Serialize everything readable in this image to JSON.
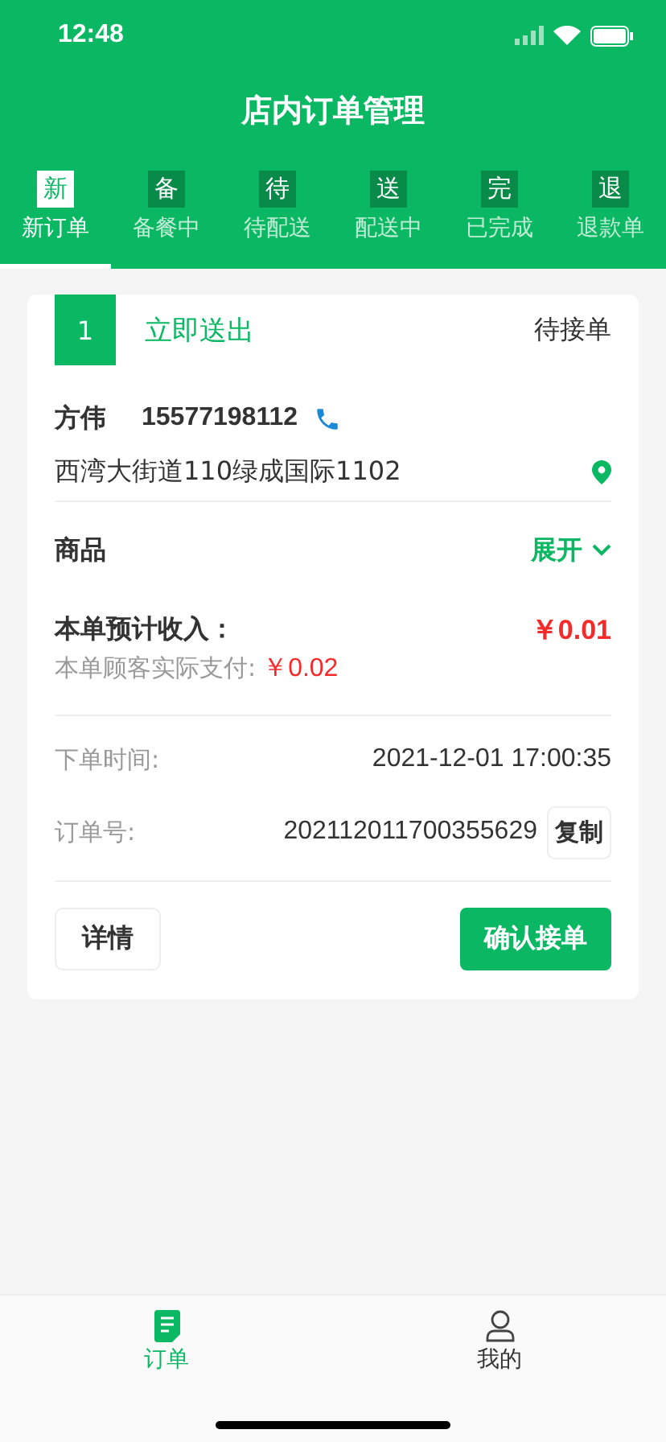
{
  "status_bar": {
    "time": "12:48"
  },
  "header": {
    "title": "店内订单管理"
  },
  "tabs": [
    {
      "icon_char": "新",
      "label": "新订单",
      "selected": true
    },
    {
      "icon_char": "备",
      "label": "备餐中",
      "selected": false
    },
    {
      "icon_char": "待",
      "label": "待配送",
      "selected": false
    },
    {
      "icon_char": "送",
      "label": "配送中",
      "selected": false
    },
    {
      "icon_char": "完",
      "label": "已完成",
      "selected": false
    },
    {
      "icon_char": "退",
      "label": "退款单",
      "selected": false
    }
  ],
  "order": {
    "number": "1",
    "delivery": "立即送出",
    "status": "待接单",
    "customer_name": "方伟",
    "phone": "15577198112",
    "address": "西湾大街道110绿成国际1102",
    "goods_label": "商品",
    "expand_label": "展开",
    "income_label": "本单预计收入：",
    "income": "￥0.01",
    "paid_label": "本单顾客实际支付:",
    "paid": "￥0.02",
    "time_label": "下单时间:",
    "time": "2021-12-01 17:00:35",
    "order_no_label": "订单号:",
    "order_no": "202112011700355629",
    "copy_button": "复制",
    "details_button": "详情",
    "confirm_button": "确认接单"
  },
  "bottom_nav": [
    {
      "label": "订单",
      "kind": "document",
      "selected": true
    },
    {
      "label": "我的",
      "kind": "person",
      "selected": false
    }
  ]
}
